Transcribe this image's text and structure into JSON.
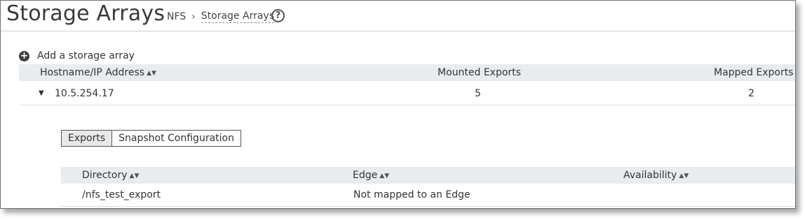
{
  "page": {
    "title": "Storage Arrays",
    "breadcrumb": {
      "parent": "NFS",
      "separator": "›",
      "current": "Storage Arrays"
    },
    "help_symbol": "?"
  },
  "add_array": {
    "icon": "plus-circle-icon",
    "label": "Add a storage array"
  },
  "arrays_table": {
    "columns": {
      "hostname": "Hostname/IP Address",
      "mounted": "Mounted Exports",
      "mapped": "Mapped Exports"
    },
    "rows": [
      {
        "expand_symbol": "▼",
        "hostname": "10.5.254.17",
        "mounted": "5",
        "mapped": "2"
      }
    ]
  },
  "detail_tabs": {
    "active": "Exports",
    "other": "Snapshot Configuration"
  },
  "exports_table": {
    "columns": {
      "directory": "Directory",
      "edge": "Edge",
      "availability": "Availability"
    },
    "rows": [
      {
        "directory": "/nfs_test_export",
        "edge": "Not mapped to an Edge",
        "availability": ""
      }
    ]
  },
  "sort_symbol": "▲▼",
  "colors": {
    "header_bg": "#e9ecef",
    "text": "#333333",
    "border": "#6f6f6f"
  }
}
